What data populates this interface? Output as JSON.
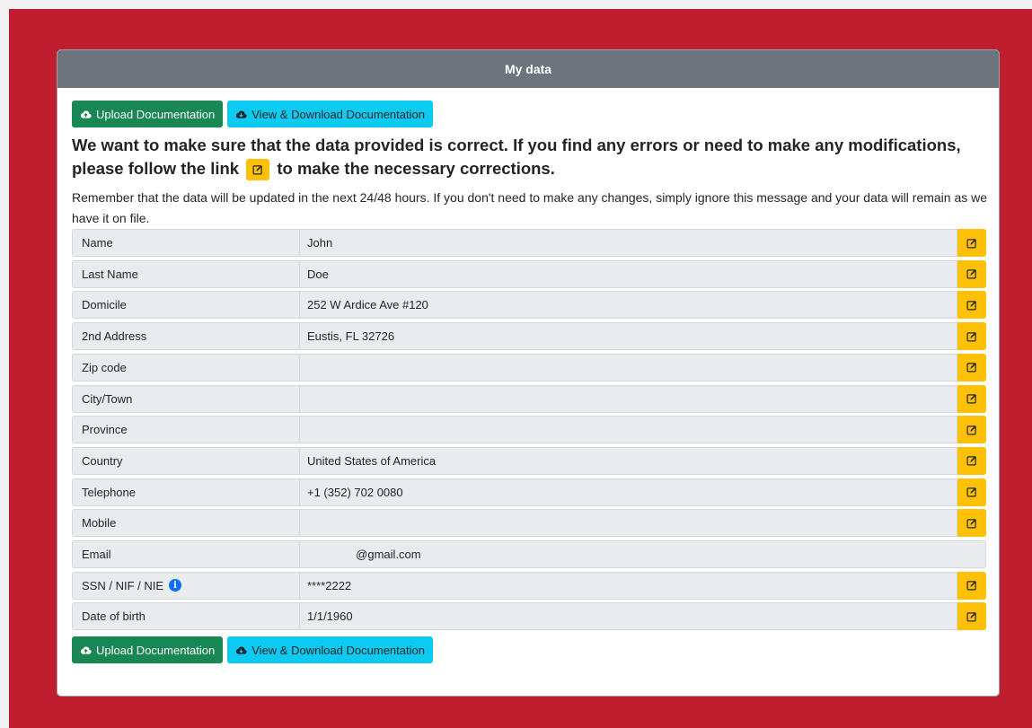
{
  "header": {
    "title": "My data"
  },
  "buttons": {
    "upload_label": "Upload Documentation",
    "view_label": "View & Download Documentation"
  },
  "intro": {
    "headline_part1": "We want to make sure that the data provided is correct. If you find any errors or need to make any modifications, please follow the link",
    "headline_part2": "to make the necessary corrections.",
    "note": "Remember that the data will be updated in the next 24/48 hours. If you don't need to make any changes, simply ignore this message and your data will remain as we have it on file."
  },
  "fields": [
    {
      "label": "Name",
      "value": "John",
      "editable": true
    },
    {
      "label": "Last Name",
      "value": "Doe",
      "editable": true
    },
    {
      "label": "Domicile",
      "value": "252 W Ardice Ave #120",
      "editable": true
    },
    {
      "label": "2nd Address",
      "value": "Eustis, FL 32726",
      "editable": true
    },
    {
      "label": "Zip code",
      "value": "",
      "editable": true
    },
    {
      "label": "City/Town",
      "value": "",
      "editable": true
    },
    {
      "label": "Province",
      "value": "",
      "editable": true
    },
    {
      "label": "Country",
      "value": "United States of America",
      "editable": true
    },
    {
      "label": "Telephone",
      "value": "+1 (352) 702 0080",
      "editable": true
    },
    {
      "label": "Mobile",
      "value": "",
      "editable": true
    },
    {
      "label": "Email",
      "value": "               @gmail.com",
      "editable": false
    },
    {
      "label": "SSN / NIF / NIE",
      "value": "****2222",
      "editable": true,
      "info_icon": "i"
    },
    {
      "label": "Date of birth",
      "value": "1/1/1960",
      "editable": true
    }
  ],
  "colors": {
    "frame": "#be1e2d",
    "header": "#6c757d",
    "upload_button": "#198754",
    "view_button": "#0dcaf0",
    "edit_button": "#ffc107",
    "field_bg": "#e9ecef",
    "info_icon": "#0d6efd"
  },
  "icons": {
    "upload": "cloud-upload-icon",
    "view": "cloud-download-icon",
    "edit": "edit-icon",
    "info": "info-icon"
  }
}
